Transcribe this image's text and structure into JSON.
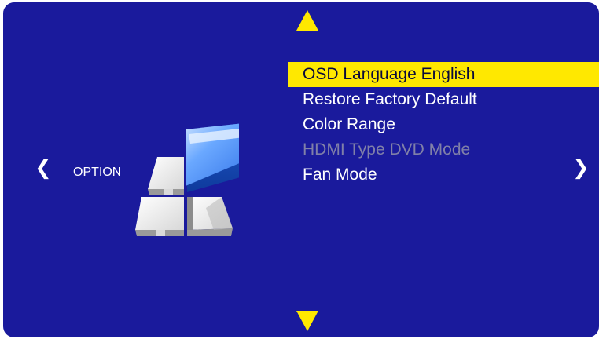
{
  "nav": {
    "up_icon": "triangle-up",
    "down_icon": "triangle-down",
    "left_glyph": "❮",
    "right_glyph": "❯"
  },
  "category": {
    "label": "OPTION",
    "icon": "option-blocks-icon"
  },
  "menu": {
    "items": [
      {
        "label": "OSD Language English",
        "state": "selected"
      },
      {
        "label": "Restore Factory Default",
        "state": "normal"
      },
      {
        "label": "Color Range",
        "state": "normal"
      },
      {
        "label": "HDMI Type DVD Mode",
        "state": "disabled"
      },
      {
        "label": "Fan Mode",
        "state": "normal"
      }
    ]
  },
  "colors": {
    "background": "#1a1a9c",
    "highlight": "#ffe800",
    "text": "#ffffff",
    "disabled_text": "#8080a8"
  }
}
